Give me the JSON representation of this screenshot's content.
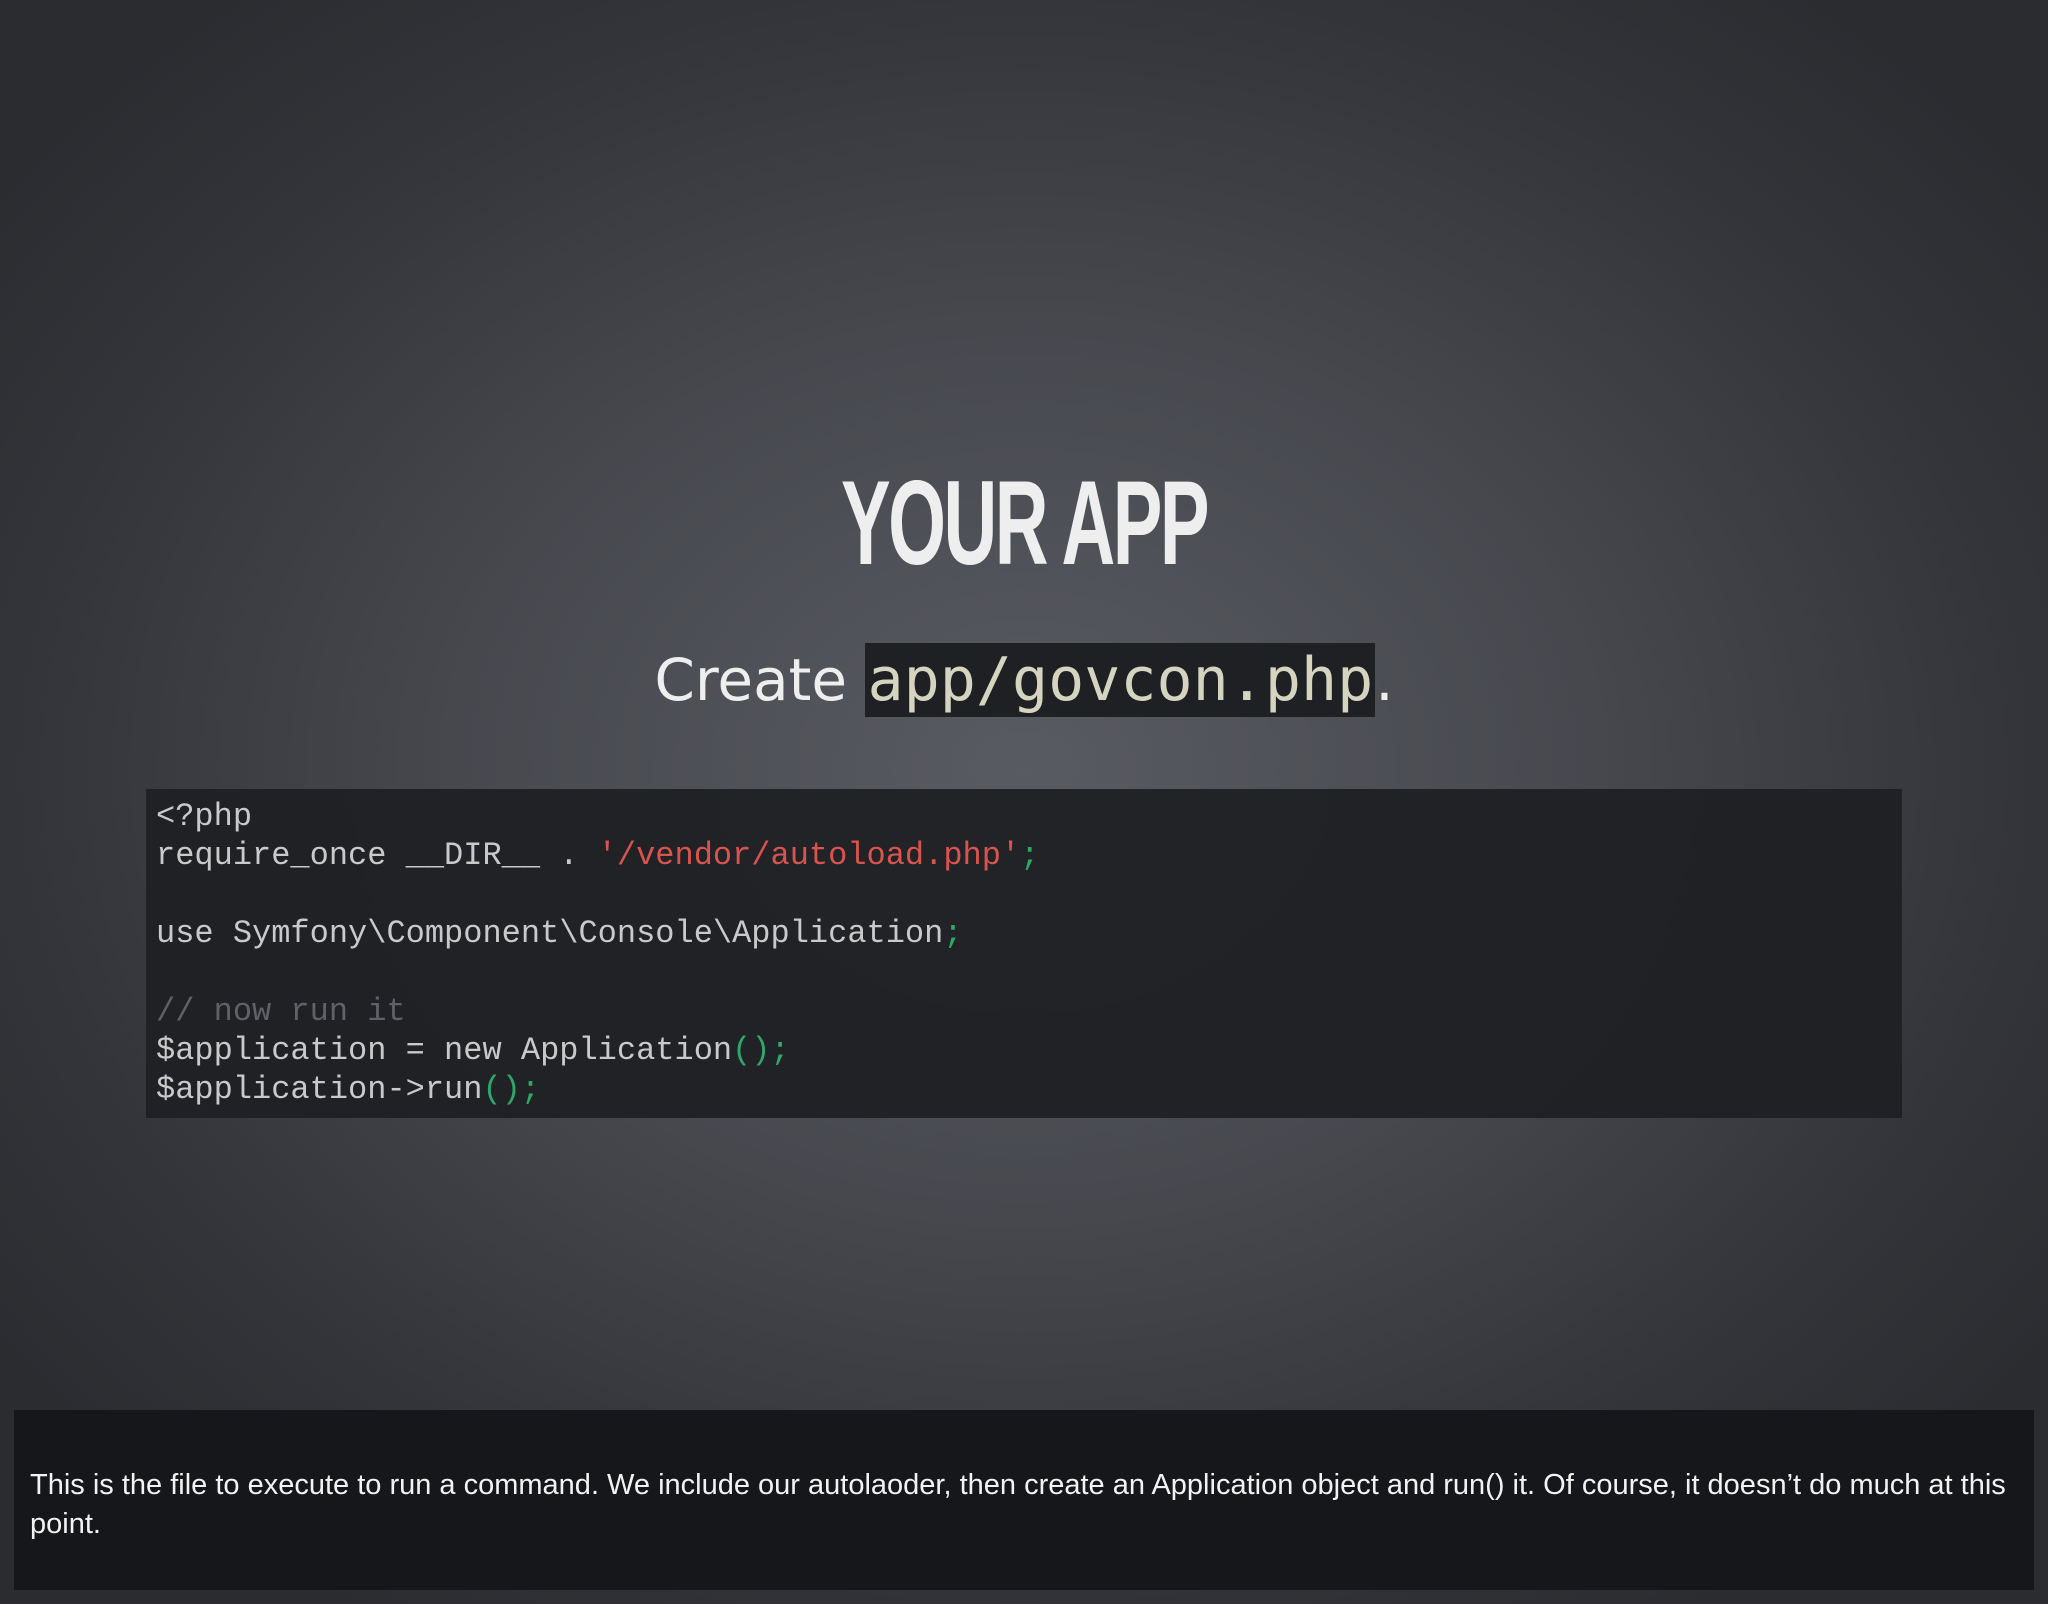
{
  "slide": {
    "title": "YOUR APP",
    "subtitle_prefix": "Create ",
    "subtitle_code": "app/govcon.php",
    "subtitle_suffix": "."
  },
  "code": {
    "line1": "<?php",
    "line2_plain": "require_once __DIR__ . ",
    "line2_string": "'/vendor/autoload.php'",
    "line2_punc": ";",
    "line4_plain": "use Symfony\\Component\\Console\\Application",
    "line4_punc": ";",
    "line6_comment": "// now run it",
    "line7_plain": "$application = new Application",
    "line7_punc": "();",
    "line8_plain": "$application->run",
    "line8_punc": "();"
  },
  "speaker_notes": {
    "text": "This is the file to execute to run a command. We include our autolaoder, then create an Application object and run() it. Of course, it doesn’t do much at this point."
  },
  "colors": {
    "string": "#d9534f",
    "punctuation": "#2ea76a",
    "comment": "#5f6166"
  }
}
